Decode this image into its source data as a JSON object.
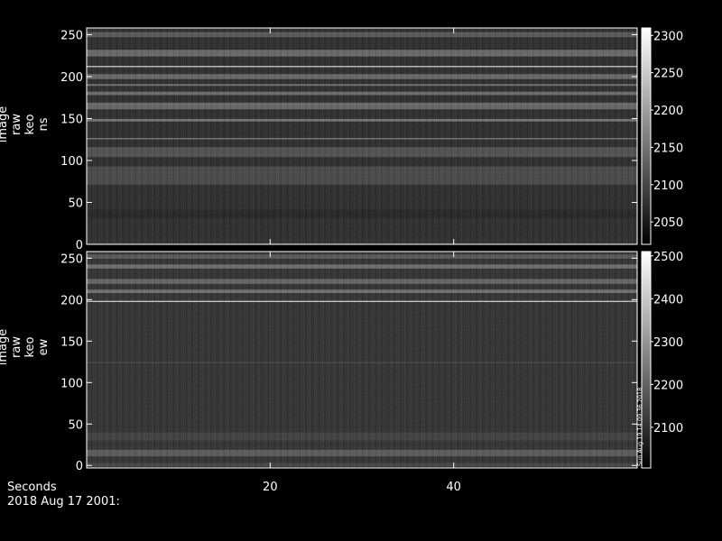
{
  "footer": {
    "x_axis_title": "Seconds",
    "date_label": "2018 Aug 17 2001:"
  },
  "colors": {
    "background": "#000000",
    "axes": "#ffffff",
    "text": "#ffffff"
  },
  "chart_data": [
    {
      "type": "heatmap",
      "ylabel": [
        "image",
        "raw",
        "keo",
        "ns"
      ],
      "x_ticks": [
        20,
        40
      ],
      "xlim": [
        0,
        60
      ],
      "y_ticks": [
        0,
        50,
        100,
        150,
        200,
        250
      ],
      "ylim": [
        0,
        258
      ],
      "colorbar": {
        "ticks": [
          2050,
          2100,
          2150,
          2200,
          2250,
          2300
        ],
        "range": [
          2020,
          2310
        ]
      },
      "base_level": 2075,
      "bands": [
        {
          "y": 1,
          "width": 2.5,
          "level": 2090
        },
        {
          "y": 36,
          "width": 10,
          "level": 2065
        },
        {
          "y": 82,
          "width": 22,
          "level": 2110
        },
        {
          "y": 110,
          "width": 12,
          "level": 2120
        },
        {
          "y": 126,
          "width": 1.2,
          "level": 2180
        },
        {
          "y": 148,
          "width": 3,
          "level": 2165
        },
        {
          "y": 165,
          "width": 8,
          "level": 2150
        },
        {
          "y": 180,
          "width": 4,
          "level": 2155
        },
        {
          "y": 190,
          "width": 2,
          "level": 2170
        },
        {
          "y": 200,
          "width": 6,
          "level": 2150
        },
        {
          "y": 212,
          "width": 1,
          "level": 2310
        },
        {
          "y": 228,
          "width": 8,
          "level": 2150
        },
        {
          "y": 250,
          "width": 6,
          "level": 2130
        }
      ]
    },
    {
      "type": "heatmap",
      "ylabel": [
        "image",
        "raw",
        "keo",
        "ew"
      ],
      "x_ticks": [
        20,
        40
      ],
      "xlim": [
        0,
        60
      ],
      "y_ticks": [
        0,
        50,
        100,
        150,
        200,
        250
      ],
      "ylim": [
        -3,
        258
      ],
      "colorbar": {
        "ticks": [
          2100,
          2200,
          2300,
          2400,
          2500
        ],
        "range": [
          2005,
          2510
        ]
      },
      "base_level": 2110,
      "bands": [
        {
          "y": 1,
          "width": 4,
          "level": 2150
        },
        {
          "y": 15,
          "width": 8,
          "level": 2200
        },
        {
          "y": 35,
          "width": 10,
          "level": 2140
        },
        {
          "y": 124,
          "width": 1,
          "level": 2160
        },
        {
          "y": 198,
          "width": 1,
          "level": 2510
        },
        {
          "y": 210,
          "width": 4,
          "level": 2250
        },
        {
          "y": 222,
          "width": 6,
          "level": 2220
        },
        {
          "y": 240,
          "width": 5,
          "level": 2240
        },
        {
          "y": 252,
          "width": 5,
          "level": 2200
        }
      ],
      "annotation": "Sun Aug 19 14:09:36 2018"
    }
  ]
}
